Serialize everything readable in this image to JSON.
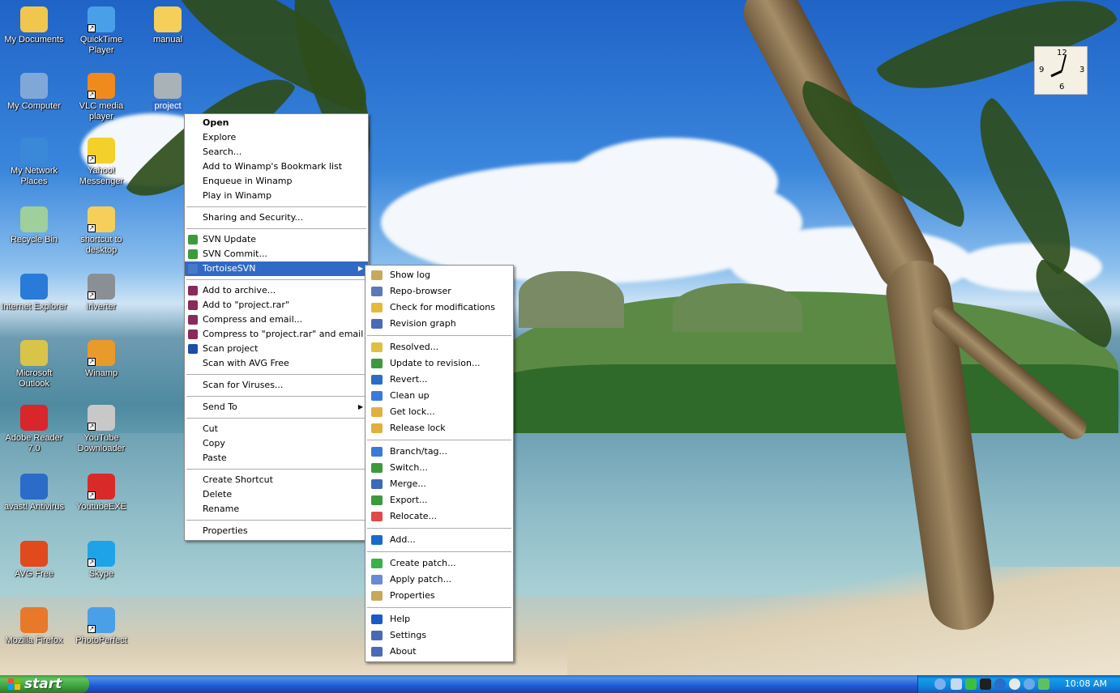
{
  "desktop_icons": [
    {
      "label": "My Documents",
      "icon": "my-documents-icon",
      "color": "#f0c64c"
    },
    {
      "label": "QuickTime Player",
      "icon": "quicktime-icon",
      "color": "#4aa0e8"
    },
    {
      "label": "manual",
      "icon": "folder-icon",
      "color": "#f5cf5a"
    },
    {
      "label": "My Computer",
      "icon": "my-computer-icon",
      "color": "#7fa8d9"
    },
    {
      "label": "VLC media player",
      "icon": "vlc-icon",
      "color": "#f08a1c"
    },
    {
      "label": "project",
      "icon": "svn-folder-icon",
      "color": "#a8b2b8"
    },
    {
      "label": "My Network Places",
      "icon": "network-places-icon",
      "color": "#3a88d8"
    },
    {
      "label": "Yahoo! Messenger",
      "icon": "yahoo-messenger-icon",
      "color": "#f3d12a"
    },
    {
      "label": "Recycle Bin",
      "icon": "recycle-bin-icon",
      "color": "#9fcf9a"
    },
    {
      "label": "shortcut to desktop",
      "icon": "folder-shortcut-icon",
      "color": "#f5cf5a"
    },
    {
      "label": "Internet Explorer",
      "icon": "internet-explorer-icon",
      "color": "#2a7ad8"
    },
    {
      "label": "iriverter",
      "icon": "iriverter-icon",
      "color": "#8a8f95"
    },
    {
      "label": "Microsoft Outlook",
      "icon": "outlook-icon",
      "color": "#d9c44a"
    },
    {
      "label": "Winamp",
      "icon": "winamp-icon",
      "color": "#e89a2a"
    },
    {
      "label": "Adobe Reader 7.0",
      "icon": "adobe-reader-icon",
      "color": "#d8262a"
    },
    {
      "label": "YouTube Downloader",
      "icon": "youtube-downloader-icon",
      "color": "#c8c8c8"
    },
    {
      "label": "avast! Antivirus",
      "icon": "avast-icon",
      "color": "#2a6cc8"
    },
    {
      "label": "YoutubeEXE",
      "icon": "youtube-exe-icon",
      "color": "#d92a2a"
    },
    {
      "label": "AVG Free",
      "icon": "avg-icon",
      "color": "#e04a1c"
    },
    {
      "label": "Skype",
      "icon": "skype-icon",
      "color": "#1fa3e8"
    },
    {
      "label": "Mozilla Firefox",
      "icon": "firefox-icon",
      "color": "#e8782a"
    },
    {
      "label": "PhotoPerfect",
      "icon": "photoperfect-icon",
      "color": "#4aa0e8"
    }
  ],
  "context_menu": {
    "items": [
      {
        "label": "Open",
        "bold": true
      },
      {
        "label": "Explore"
      },
      {
        "label": "Search..."
      },
      {
        "label": "Add to Winamp's Bookmark list"
      },
      {
        "label": "Enqueue in Winamp"
      },
      {
        "label": "Play in Winamp"
      },
      {
        "sep": true
      },
      {
        "label": "Sharing and Security..."
      },
      {
        "sep": true
      },
      {
        "label": "SVN Update",
        "icon": "svn-update-icon",
        "color": "#3c9a3c"
      },
      {
        "label": "SVN Commit...",
        "icon": "svn-commit-icon",
        "color": "#3c9a3c"
      },
      {
        "label": "TortoiseSVN",
        "icon": "tortoise-icon",
        "color": "#4a78c8",
        "submenu": true,
        "highlighted": true
      },
      {
        "sep": true
      },
      {
        "label": "Add to archive...",
        "icon": "winrar-icon",
        "color": "#8a2a5a"
      },
      {
        "label": "Add to \"project.rar\"",
        "icon": "winrar-icon",
        "color": "#8a2a5a"
      },
      {
        "label": "Compress and email...",
        "icon": "winrar-icon",
        "color": "#8a2a5a"
      },
      {
        "label": "Compress to \"project.rar\" and email",
        "icon": "winrar-icon",
        "color": "#8a2a5a"
      },
      {
        "label": "Scan project",
        "icon": "avast-icon",
        "color": "#1c4ea8"
      },
      {
        "label": "Scan with AVG Free"
      },
      {
        "sep": true
      },
      {
        "label": "Scan for Viruses..."
      },
      {
        "sep": true
      },
      {
        "label": "Send To",
        "submenu": true
      },
      {
        "sep": true
      },
      {
        "label": "Cut"
      },
      {
        "label": "Copy"
      },
      {
        "label": "Paste"
      },
      {
        "sep": true
      },
      {
        "label": "Create Shortcut"
      },
      {
        "label": "Delete"
      },
      {
        "label": "Rename"
      },
      {
        "sep": true
      },
      {
        "label": "Properties"
      }
    ]
  },
  "tortoise_menu": {
    "items": [
      {
        "label": "Show log",
        "icon": "show-log-icon",
        "color": "#c8a85a"
      },
      {
        "label": "Repo-browser",
        "icon": "repo-browser-icon",
        "color": "#5a7ab8"
      },
      {
        "label": "Check for modifications",
        "icon": "check-modifications-icon",
        "color": "#e8b83a"
      },
      {
        "label": "Revision graph",
        "icon": "revision-graph-icon",
        "color": "#4a6ab8"
      },
      {
        "sep": true
      },
      {
        "label": "Resolved...",
        "icon": "resolved-icon",
        "color": "#e0c040"
      },
      {
        "label": "Update to revision...",
        "icon": "update-revision-icon",
        "color": "#3c9a3c"
      },
      {
        "label": "Revert...",
        "icon": "revert-icon",
        "color": "#2a6cc8"
      },
      {
        "label": "Clean up",
        "icon": "clean-up-icon",
        "color": "#3a7ad8"
      },
      {
        "label": "Get lock...",
        "icon": "lock-icon",
        "color": "#e0b040"
      },
      {
        "label": "Release lock",
        "icon": "unlock-icon",
        "color": "#e0b040"
      },
      {
        "sep": true
      },
      {
        "label": "Branch/tag...",
        "icon": "branch-tag-icon",
        "color": "#3a7ad8"
      },
      {
        "label": "Switch...",
        "icon": "switch-icon",
        "color": "#3c9a3c"
      },
      {
        "label": "Merge...",
        "icon": "merge-icon",
        "color": "#3a6ab8"
      },
      {
        "label": "Export...",
        "icon": "export-icon",
        "color": "#3c9a3c"
      },
      {
        "label": "Relocate...",
        "icon": "relocate-icon",
        "color": "#e04a4a"
      },
      {
        "sep": true
      },
      {
        "label": "Add...",
        "icon": "add-icon",
        "color": "#1a6ac8"
      },
      {
        "sep": true
      },
      {
        "label": "Create patch...",
        "icon": "create-patch-icon",
        "color": "#3ab04a"
      },
      {
        "label": "Apply patch...",
        "icon": "apply-patch-icon",
        "color": "#6a8ad8"
      },
      {
        "label": "Properties",
        "icon": "properties-icon",
        "color": "#c8a85a"
      },
      {
        "sep": true
      },
      {
        "label": "Help",
        "icon": "help-icon",
        "color": "#1a5ac8"
      },
      {
        "label": "Settings",
        "icon": "settings-icon",
        "color": "#4a6ab8"
      },
      {
        "label": "About",
        "icon": "about-icon",
        "color": "#4a6ab8"
      }
    ]
  },
  "clock": {
    "n12": "12",
    "n3": "3",
    "n6": "6",
    "n9": "9"
  },
  "taskbar": {
    "start_label": "start",
    "time": "10:08 AM"
  }
}
